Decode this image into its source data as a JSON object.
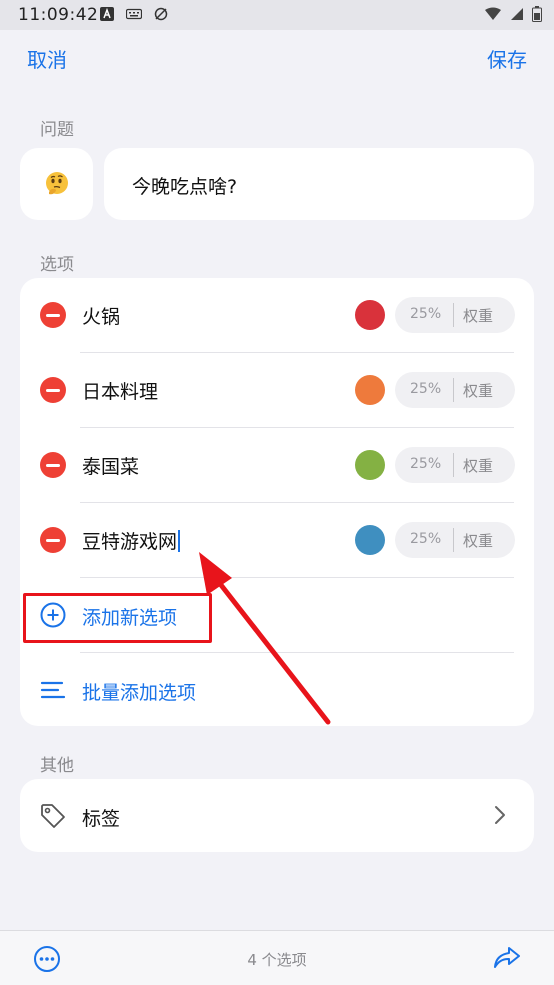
{
  "status_bar": {
    "time": "11:09:42",
    "icons": [
      "a-notification-icon",
      "keyboard-icon",
      "cast-off-icon",
      "wifi-icon",
      "signal-icon",
      "battery-icon"
    ]
  },
  "nav": {
    "cancel_label": "取消",
    "save_label": "保存"
  },
  "question": {
    "section_label": "问题",
    "emoji": "🤔",
    "text": "今晚吃点啥?"
  },
  "options": {
    "section_label": "选项",
    "items": [
      {
        "name": "火锅",
        "color": "#d9323b",
        "percent": "25%",
        "weight_label": "权重"
      },
      {
        "name": "日本料理",
        "color": "#ee7a3c",
        "percent": "25%",
        "weight_label": "权重"
      },
      {
        "name": "泰国菜",
        "color": "#84b143",
        "percent": "25%",
        "weight_label": "权重"
      },
      {
        "name": "豆特游戏网",
        "color": "#3f8fc0",
        "percent": "25%",
        "weight_label": "权重"
      }
    ],
    "add_label": "添加新选项",
    "batch_label": "批量添加选项"
  },
  "other": {
    "section_label": "其他",
    "tag_label": "标签"
  },
  "bottom": {
    "option_count": "4 个选项"
  },
  "colors": {
    "accent": "#1a73e8",
    "remove": "#ee4035",
    "annotation": "#e8141b"
  }
}
